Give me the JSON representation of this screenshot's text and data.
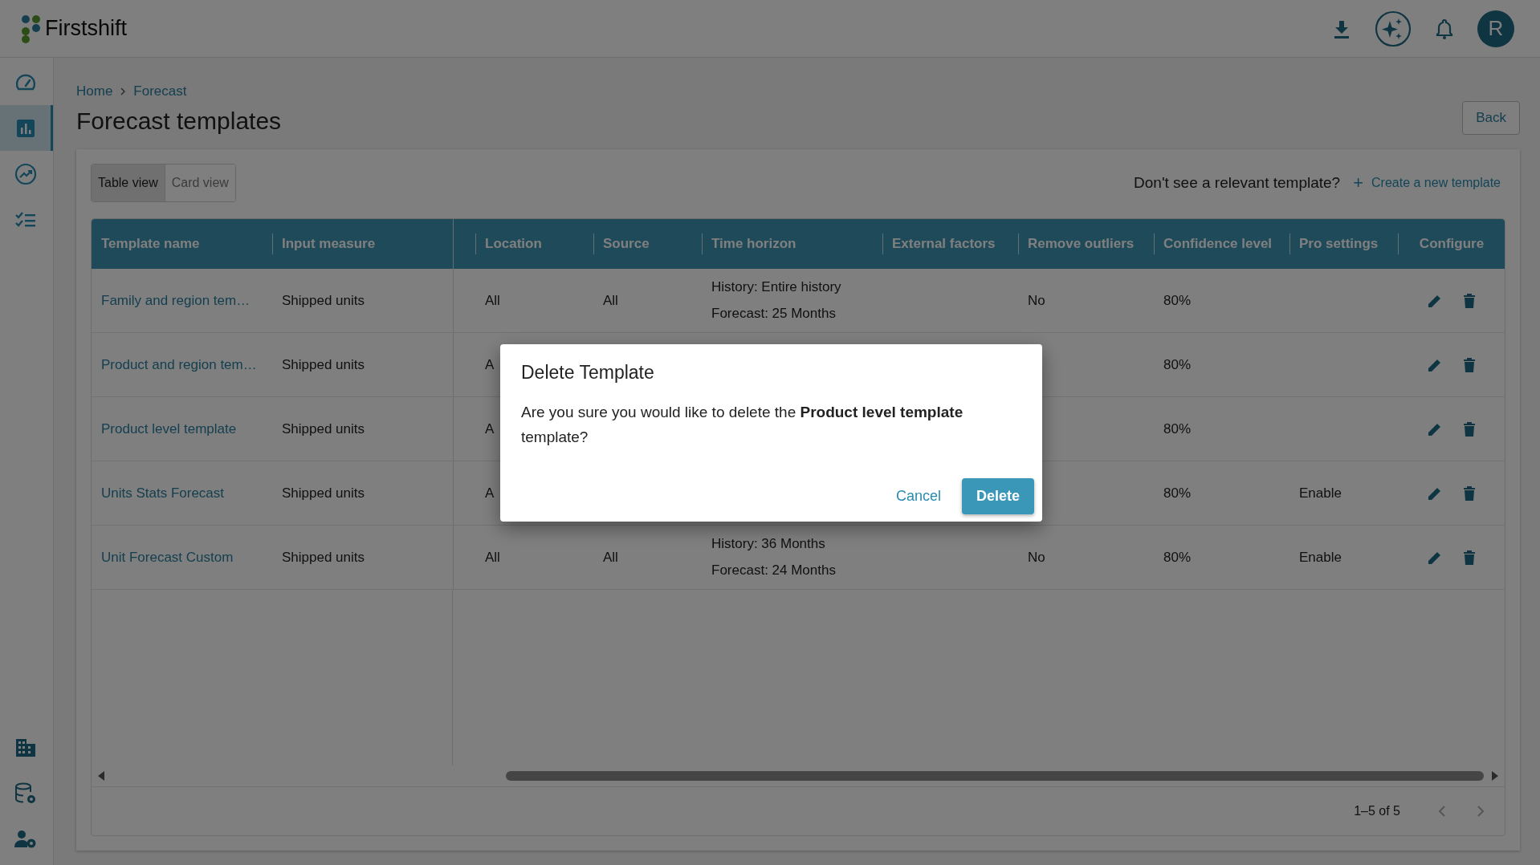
{
  "header": {
    "brand": "**First**shift",
    "avatar": "R"
  },
  "sidebar": {
    "items": [
      {
        "selected": false
      },
      {
        "selected": true
      },
      {
        "selected": false
      },
      {
        "selected": false
      }
    ],
    "bottom_items": [
      {
        "selected": false
      },
      {
        "selected": false
      },
      {
        "selected": false
      }
    ]
  },
  "breadcrumb": [
    "Home",
    "Forecast"
  ],
  "title": "Forecast templates",
  "back_button": "Back",
  "view_tabs": [
    {
      "label": "Table view",
      "selected": true
    },
    {
      "label": "Card view",
      "selected": false
    }
  ],
  "prompt": "Don't see a relevant template?",
  "create_link": "Create a new template",
  "create_icon": "+",
  "table": {
    "columns": [
      "Template name",
      "Input measure",
      "Location",
      "Source",
      "Time horizon",
      "External factors",
      "Remove outliers",
      "Confidence level",
      "Pro settings",
      "Configure"
    ],
    "rows": [
      {
        "template_name": "Family and region tem…",
        "input_measure": "Shipped units",
        "location": "All",
        "source": "All",
        "time_horizon": [
          "History: Entire history",
          "Forecast: 25 Months"
        ],
        "remove_outliers": "No",
        "confidence_level": "80%"
      },
      {
        "template_name": "Product and region tem…",
        "input_measure": "Shipped units",
        "location": "A",
        "confidence_level": "80%"
      },
      {
        "template_name": "Product level template",
        "input_measure": "Shipped units",
        "location": "A",
        "confidence_level": "80%"
      },
      {
        "template_name": "Units Stats Forecast",
        "input_measure": "Shipped units",
        "location": "A",
        "confidence_level": "80%",
        "pro_settings": "Enable"
      },
      {
        "template_name": "Unit Forecast Custom",
        "input_measure": "Shipped units",
        "location": "All",
        "source": "All",
        "time_horizon": [
          "History: 36 Months",
          "Forecast: 24 Months"
        ],
        "remove_outliers": "No",
        "confidence_level": "80%",
        "pro_settings": "Enable"
      }
    ]
  },
  "pagination": "1–5 of 5",
  "dialog": {
    "title": "Delete Template",
    "message": "Are you sure you would like to delete the **Product level template** template?",
    "cancel": "Cancel",
    "confirm": "Delete"
  }
}
